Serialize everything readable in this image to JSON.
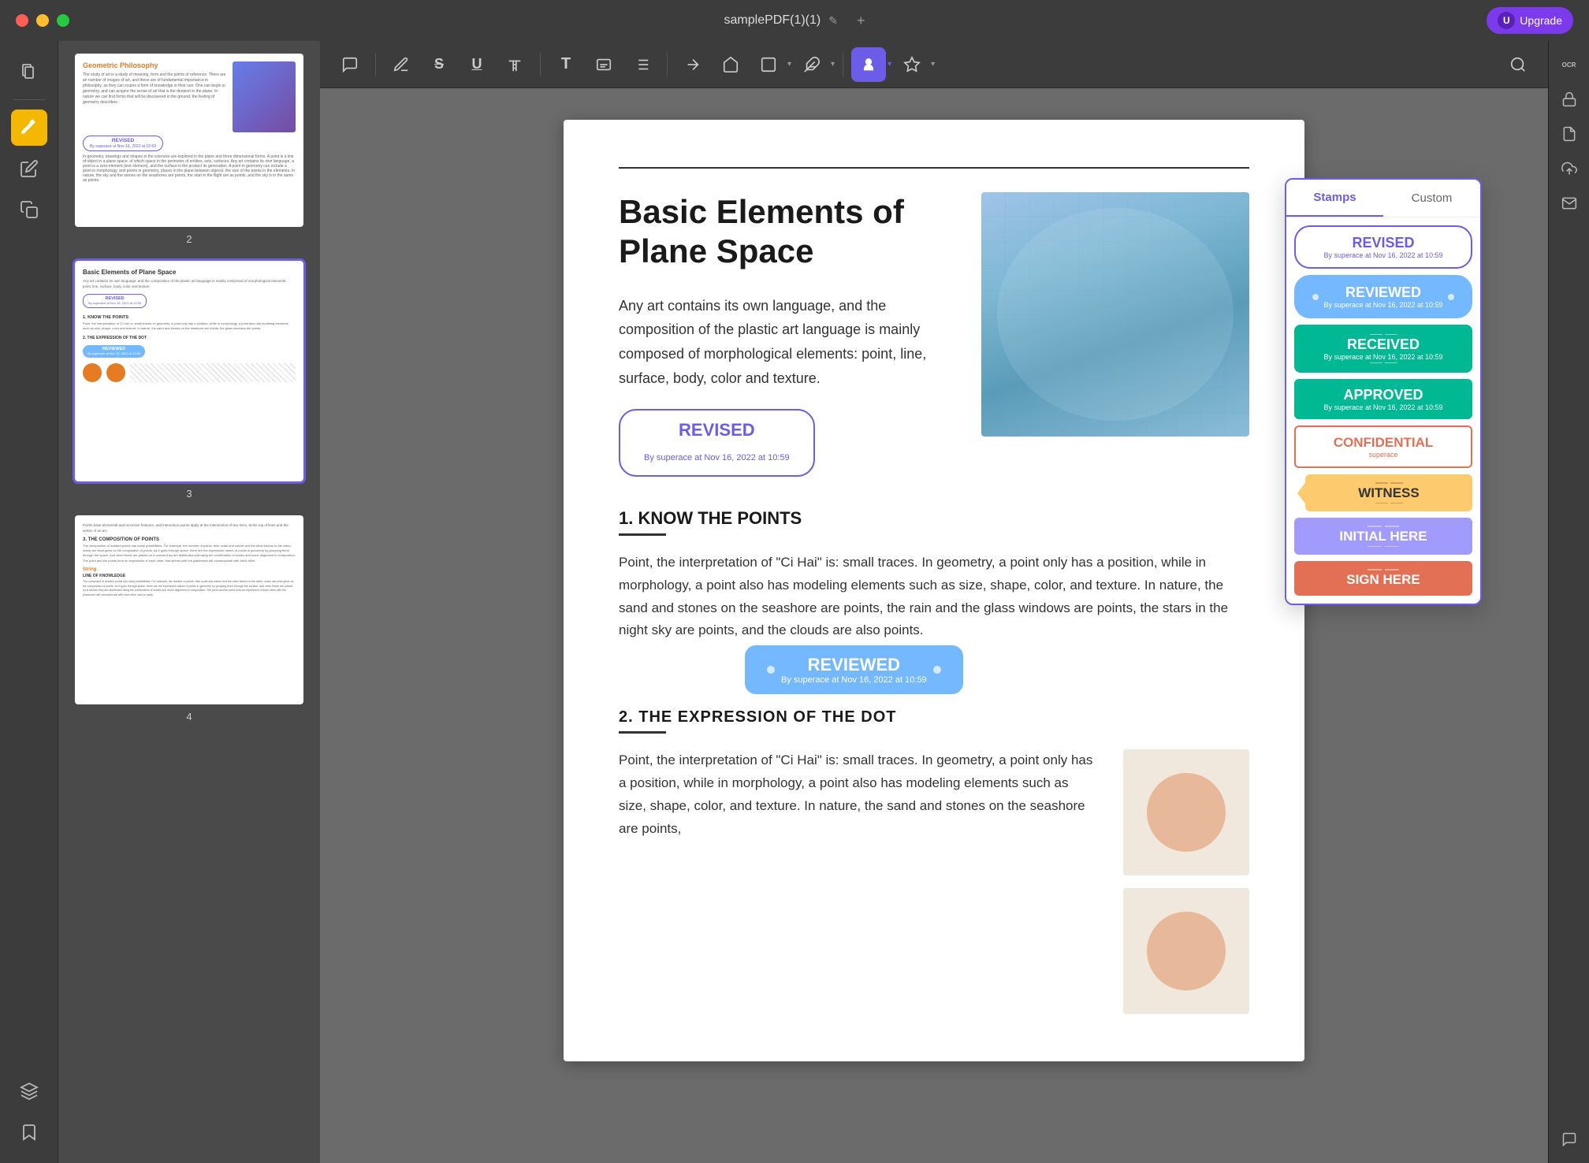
{
  "titlebar": {
    "filename": "samplePDF(1)(1)",
    "upgrade_label": "Upgrade",
    "upgrade_letter": "U",
    "add_tab": "+"
  },
  "toolbar": {
    "tools": [
      {
        "name": "comment-tool",
        "icon": "☰",
        "label": "Comment"
      },
      {
        "name": "pen-tool",
        "icon": "✒",
        "label": "Pen"
      },
      {
        "name": "strikethrough-tool",
        "icon": "S",
        "label": "Strikethrough"
      },
      {
        "name": "underline-tool",
        "icon": "U",
        "label": "Underline"
      },
      {
        "name": "text-format-tool",
        "icon": "T",
        "label": "Text Format"
      },
      {
        "name": "text-tool",
        "icon": "T",
        "label": "Text"
      },
      {
        "name": "textbox-tool",
        "icon": "⊡",
        "label": "Textbox"
      },
      {
        "name": "list-tool",
        "icon": "≡",
        "label": "List"
      },
      {
        "name": "line-tool",
        "icon": "╱",
        "label": "Line"
      },
      {
        "name": "shape-tool",
        "icon": "⌐",
        "label": "Shape"
      },
      {
        "name": "rectangle-tool",
        "icon": "▭",
        "label": "Rectangle"
      },
      {
        "name": "draw-tool",
        "icon": "✏",
        "label": "Draw"
      },
      {
        "name": "stamp-tool",
        "icon": "👤",
        "label": "Stamp",
        "active": true
      },
      {
        "name": "color-tool",
        "icon": "🖊",
        "label": "Color"
      },
      {
        "name": "search-tool",
        "icon": "🔍",
        "label": "Search"
      }
    ]
  },
  "stamp_panel": {
    "tab_stamps": "Stamps",
    "tab_custom": "Custom",
    "active_tab": "Stamps",
    "stamps": [
      {
        "id": "revised",
        "main": "REVISED",
        "sub": "By superace at Nov 16, 2022 at 10:59",
        "style": "revised"
      },
      {
        "id": "reviewed",
        "main": "REVIEWED",
        "sub": "By superace at Nov 16, 2022 at 10:59",
        "style": "reviewed"
      },
      {
        "id": "received",
        "main": "RECEIVED",
        "sub": "By superace at Nov 16, 2022 at 10:59",
        "style": "received"
      },
      {
        "id": "approved",
        "main": "APPROVED",
        "sub": "By superace at Nov 16, 2022 at 10:59",
        "style": "approved"
      },
      {
        "id": "confidential",
        "main": "CONFIDENTIAL",
        "sub": "superace",
        "style": "confidential"
      },
      {
        "id": "witness",
        "main": "WITNESS",
        "sub": "",
        "style": "witness"
      },
      {
        "id": "initial-here",
        "main": "INITIAL HERE",
        "sub": "",
        "style": "initial"
      },
      {
        "id": "sign-here",
        "main": "SIGN HERE",
        "sub": "",
        "style": "sign"
      }
    ]
  },
  "document": {
    "title": "Basic Elements of\nPlane Space",
    "intro": "Any art contains its own language, and the composition of the plastic art language is mainly composed of morphological elements: point, line, surface, body, color and texture.",
    "stamp_revised_main": "REVISED",
    "stamp_revised_sub": "By superace at Nov 16, 2022 at 10:59",
    "section1_title": "1. KNOW THE POINTS",
    "section1_body": "Point, the interpretation of \"Ci Hai\" is: small traces. In geometry, a point only has a position, while in morphology, a point also has modeling elements such as size, shape, color, and texture. In nature, the sand and stones on the seashore are points, the rain and the glass windows are points, the stars in the night sky are points, and the clouds are also points.",
    "stamp_reviewed_main": "REVIEWED",
    "stamp_reviewed_sub": "By superace at Nov 16, 2022 at 10:59",
    "section2_title": "2. THE EXPRESSION OF THE DOT",
    "section2_body": "Point, the interpretation of \"Ci Hai\" is: small traces. In geometry, a point only has a position, while in morphology, a point also has modeling elements such as size, shape, color, and texture. In nature, the sand and stones on the seashore are points,"
  },
  "sidebar": {
    "icons": [
      {
        "name": "pages-icon",
        "icon": "⊞",
        "active": false
      },
      {
        "name": "highlight-icon",
        "icon": "🖊",
        "active": true
      },
      {
        "name": "edit-icon",
        "icon": "✏",
        "active": false
      },
      {
        "name": "copy-icon",
        "icon": "⧉",
        "active": false
      },
      {
        "name": "layers-icon",
        "icon": "⧖",
        "active": false
      },
      {
        "name": "bookmark-icon",
        "icon": "🔖",
        "active": false
      }
    ]
  },
  "right_strip": {
    "icons": [
      {
        "name": "ocr-icon",
        "label": "OCR"
      },
      {
        "name": "pdf-protect-icon",
        "label": "PDF"
      },
      {
        "name": "upload-icon",
        "label": "↑"
      },
      {
        "name": "mail-icon",
        "label": "✉"
      },
      {
        "name": "comment-right-icon",
        "label": "💬"
      }
    ]
  },
  "thumbnails": [
    {
      "page_num": "2",
      "label": "2"
    },
    {
      "page_num": "3",
      "label": "3"
    },
    {
      "page_num": "4",
      "label": "4"
    }
  ]
}
